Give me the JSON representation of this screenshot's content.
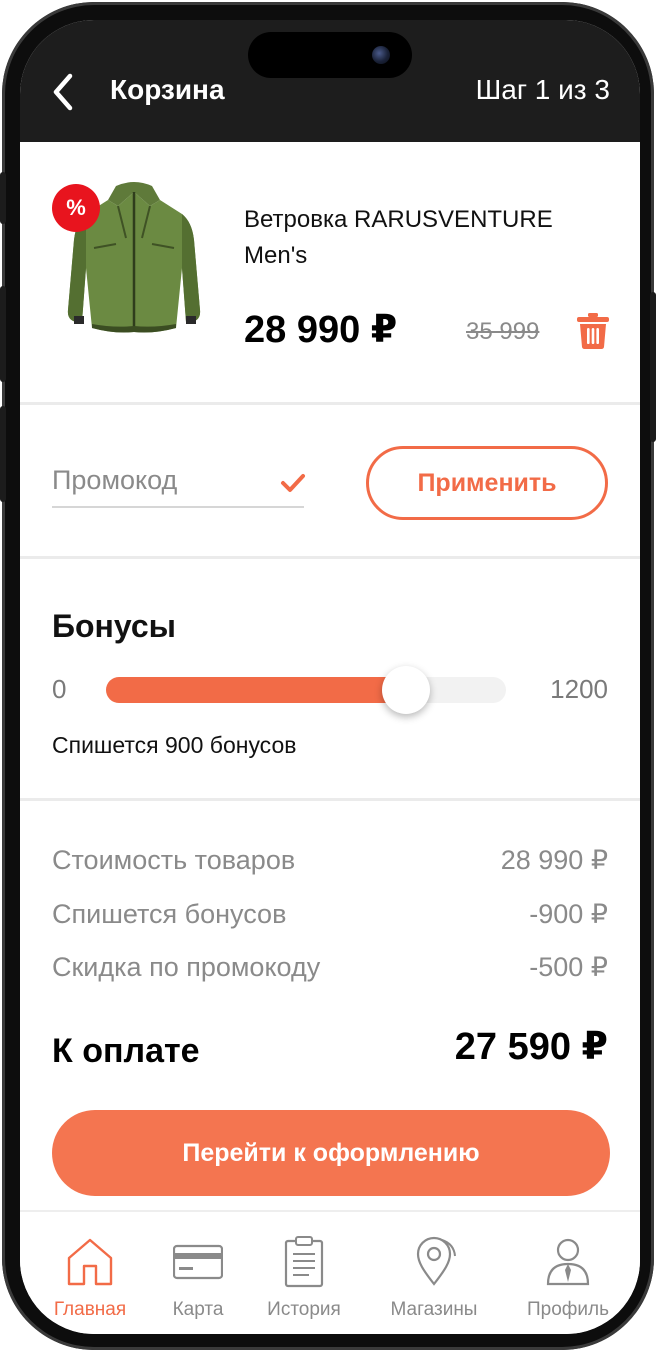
{
  "header": {
    "title": "Корзина",
    "step": "Шаг 1 из 3"
  },
  "product": {
    "badge": "%",
    "name": "Ветровка RARUSVENTURE Men's",
    "price": "28 990 ₽",
    "old_price": "35 999"
  },
  "promo": {
    "placeholder": "Промокод",
    "apply_label": "Применить"
  },
  "bonuses": {
    "title": "Бонусы",
    "min": "0",
    "max": "1200",
    "value": 900,
    "note": "Спишется 900 бонусов"
  },
  "summary": {
    "rows": [
      {
        "label": "Стоимость товаров",
        "value": "28 990 ₽"
      },
      {
        "label": "Спишется бонусов",
        "value": "-900 ₽"
      },
      {
        "label": "Скидка по промокоду",
        "value": "-500 ₽"
      }
    ],
    "total_label": "К оплате",
    "total_value": "27 590 ₽"
  },
  "checkout": {
    "label": "Перейти к оформлению"
  },
  "tabbar": {
    "items": [
      {
        "label": "Главная",
        "icon": "home-icon",
        "active": true
      },
      {
        "label": "Карта",
        "icon": "card-icon",
        "active": false
      },
      {
        "label": "История",
        "icon": "history-icon",
        "active": false
      },
      {
        "label": "Магазины",
        "icon": "map-pin-icon",
        "active": false
      },
      {
        "label": "Профиль",
        "icon": "profile-icon",
        "active": false
      }
    ]
  },
  "colors": {
    "accent": "#f26b47",
    "button": "#f47550",
    "header_bg": "#1d1d1d",
    "badge": "#e8141e"
  }
}
